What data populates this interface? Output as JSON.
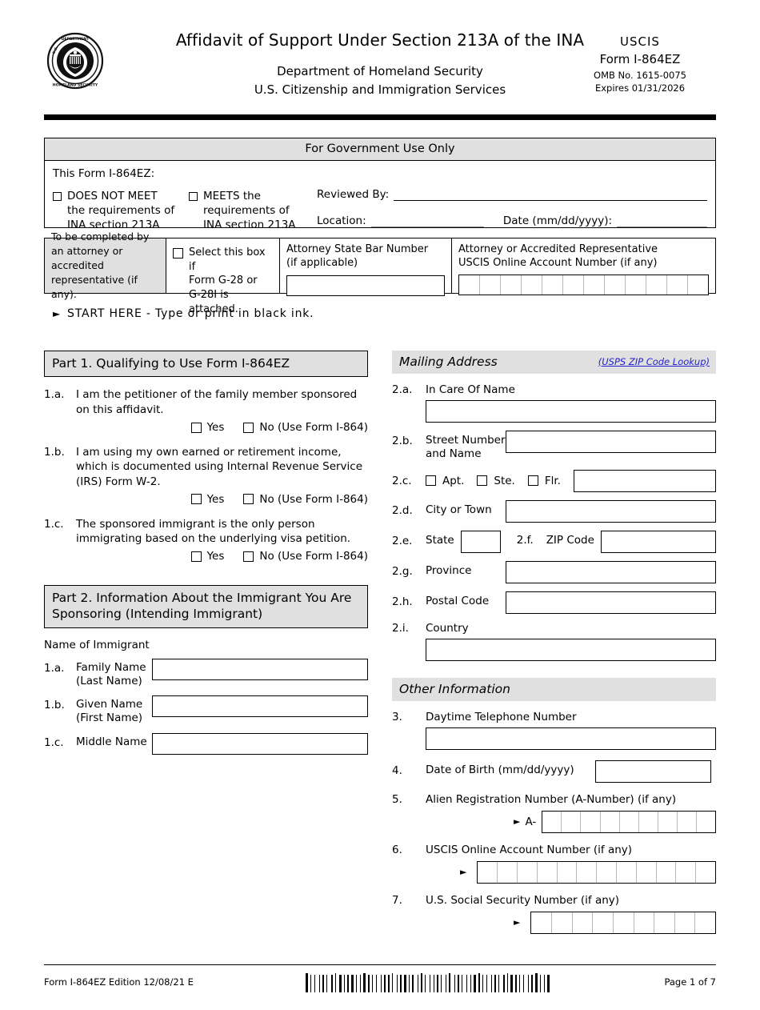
{
  "header": {
    "seal_alt": "dhs-seal",
    "title": "Affidavit of Support Under Section 213A of the INA",
    "sub1": "Department of Homeland Security",
    "sub2": "U.S. Citizenship and Immigration Services",
    "agency": "USCIS",
    "form_no": "Form I-864EZ",
    "omb": "OMB No. 1615-0075",
    "expires": "Expires 01/31/2026"
  },
  "gov_use": {
    "title": "For Government Use Only",
    "intro": "This Form I-864EZ:",
    "option_not_meet": {
      "l1": "DOES NOT MEET",
      "l2": "the requirements of",
      "l3": "INA section 213A"
    },
    "option_meets": {
      "l1": "MEETS the",
      "l2": "requirements of",
      "l3": "INA section 213A"
    },
    "reviewed_by_label": "Reviewed By:",
    "location_label": "Location:",
    "date_label": "Date (mm/dd/yyyy):"
  },
  "attorney": {
    "note": "To be completed by an attorney or accredited representative (if any).",
    "g28_l1": "Select this box if",
    "g28_l2": "Form G-28 or",
    "g28_l3": "G-28I is attached.",
    "bar_l1": "Attorney State Bar Number",
    "bar_l2": "(if applicable)",
    "acct_l1": "Attorney or Accredited Representative",
    "acct_l2": "USCIS Online Account Number (if any)",
    "acct_cells": 12
  },
  "start_here": "START HERE - Type or print in black ink.",
  "part1": {
    "header": "Part 1.  Qualifying to Use Form I-864EZ",
    "questions": [
      {
        "num": "1.a.",
        "text": "I am the petitioner of the family member sponsored on this affidavit.",
        "yes": "Yes",
        "no": "No (Use Form I-864)"
      },
      {
        "num": "1.b.",
        "text": "I am using my own earned or retirement income, which is documented using Internal Revenue Service (IRS) Form W-2.",
        "yes": "Yes",
        "no": "No (Use Form I-864)"
      },
      {
        "num": "1.c.",
        "text": "The sponsored immigrant is the only person immigrating based on the underlying visa petition.",
        "yes": "Yes",
        "no": "No (Use Form I-864)"
      }
    ]
  },
  "part2": {
    "header": "Part 2.  Information About the Immigrant You Are Sponsoring (Intending Immigrant)",
    "name_of_immigrant": "Name of Immigrant",
    "fields": [
      {
        "num": "1.a.",
        "l1": "Family Name",
        "l2": "(Last Name)",
        "value": ""
      },
      {
        "num": "1.b.",
        "l1": "Given Name",
        "l2": "(First Name)",
        "value": ""
      },
      {
        "num": "1.c.",
        "l1": "Middle Name",
        "l2": "",
        "value": ""
      }
    ]
  },
  "mailing": {
    "header": "Mailing Address",
    "zip_lookup": "(USPS ZIP Code Lookup)",
    "in_care_of": {
      "num": "2.a.",
      "label": "In Care Of Name",
      "value": ""
    },
    "street": {
      "num": "2.b.",
      "l1": "Street Number",
      "l2": "and Name",
      "value": ""
    },
    "unit": {
      "num": "2.c.",
      "apt": "Apt.",
      "ste": "Ste.",
      "flr": "Flr.",
      "value": ""
    },
    "city": {
      "num": "2.d.",
      "label": "City or Town",
      "value": ""
    },
    "state": {
      "num": "2.e.",
      "label": "State",
      "value": ""
    },
    "zip": {
      "num": "2.f.",
      "label": "ZIP Code",
      "value": ""
    },
    "province": {
      "num": "2.g.",
      "label": "Province",
      "value": ""
    },
    "postal": {
      "num": "2.h.",
      "label": "Postal Code",
      "value": ""
    },
    "country": {
      "num": "2.i.",
      "label": "Country",
      "value": ""
    }
  },
  "other": {
    "header": "Other Information",
    "phone": {
      "num": "3.",
      "label": "Daytime Telephone Number",
      "value": ""
    },
    "dob": {
      "num": "4.",
      "label": "Date of Birth (mm/dd/yyyy)",
      "value": ""
    },
    "anumber": {
      "num": "5.",
      "label": "Alien Registration Number (A-Number) (if any)",
      "prefix": "A-",
      "cells": 9
    },
    "uscis_acct": {
      "num": "6.",
      "label": "USCIS Online Account Number (if any)",
      "cells": 12
    },
    "ssn": {
      "num": "7.",
      "label": "U.S. Social Security Number (if any)",
      "cells": 9
    }
  },
  "footer": {
    "form_edition": "Form I-864EZ   Edition   12/08/21   E",
    "barcode_alt": "form-barcode",
    "page": "Page 1 of 7"
  },
  "colors": {
    "shade": "#e0e0e0",
    "link": "#2222cc",
    "rule": "#000000",
    "gray_rule": "#888888"
  }
}
